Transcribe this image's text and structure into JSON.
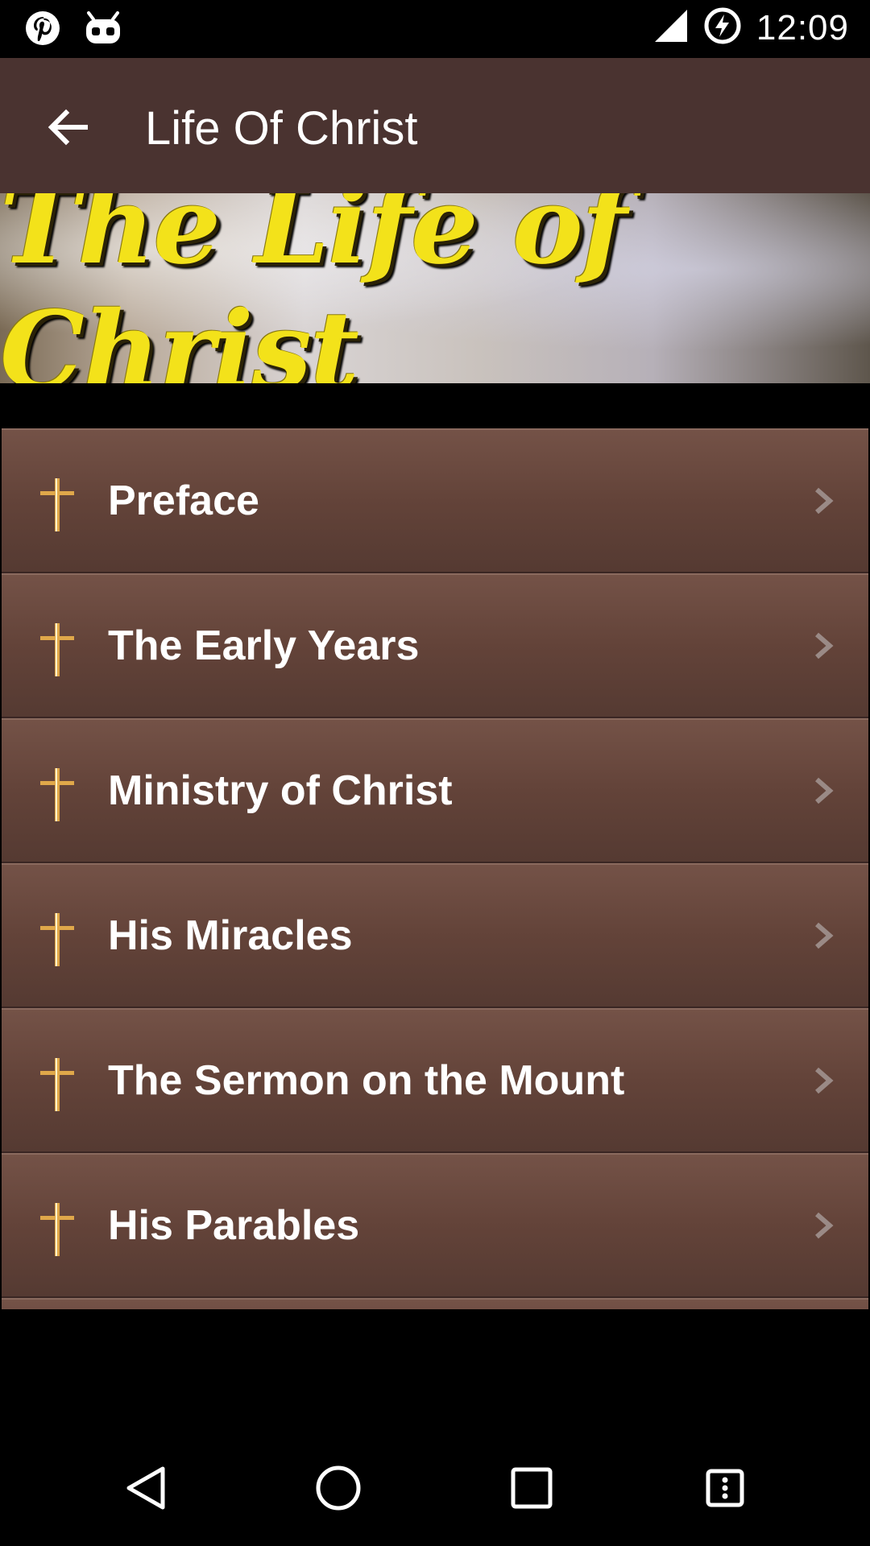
{
  "status_bar": {
    "time": "12:09",
    "left_icons": [
      "pinterest-icon",
      "android-debug-icon"
    ],
    "right_icons": [
      "signal-icon",
      "battery-charging-icon"
    ]
  },
  "app_bar": {
    "title": "Life Of Christ",
    "back_icon": "arrow-left-icon"
  },
  "banner": {
    "text": "The Life of Christ",
    "text_color": "#f3e21a"
  },
  "list": {
    "items": [
      {
        "label": "Preface",
        "icon": "cross-icon"
      },
      {
        "label": "The Early Years",
        "icon": "cross-icon"
      },
      {
        "label": "Ministry of Christ",
        "icon": "cross-icon"
      },
      {
        "label": "His Miracles",
        "icon": "cross-icon"
      },
      {
        "label": "The Sermon on the Mount",
        "icon": "cross-icon"
      },
      {
        "label": "His Parables",
        "icon": "cross-icon"
      }
    ]
  },
  "nav_bar": {
    "buttons": [
      "back-triangle-icon",
      "home-circle-icon",
      "recents-square-icon",
      "menu-icon"
    ]
  },
  "colors": {
    "app_bar": "#4a3330",
    "list_item_top": "#745247",
    "list_item_bottom": "#553a32",
    "cross_gold": "#e0a84a"
  }
}
